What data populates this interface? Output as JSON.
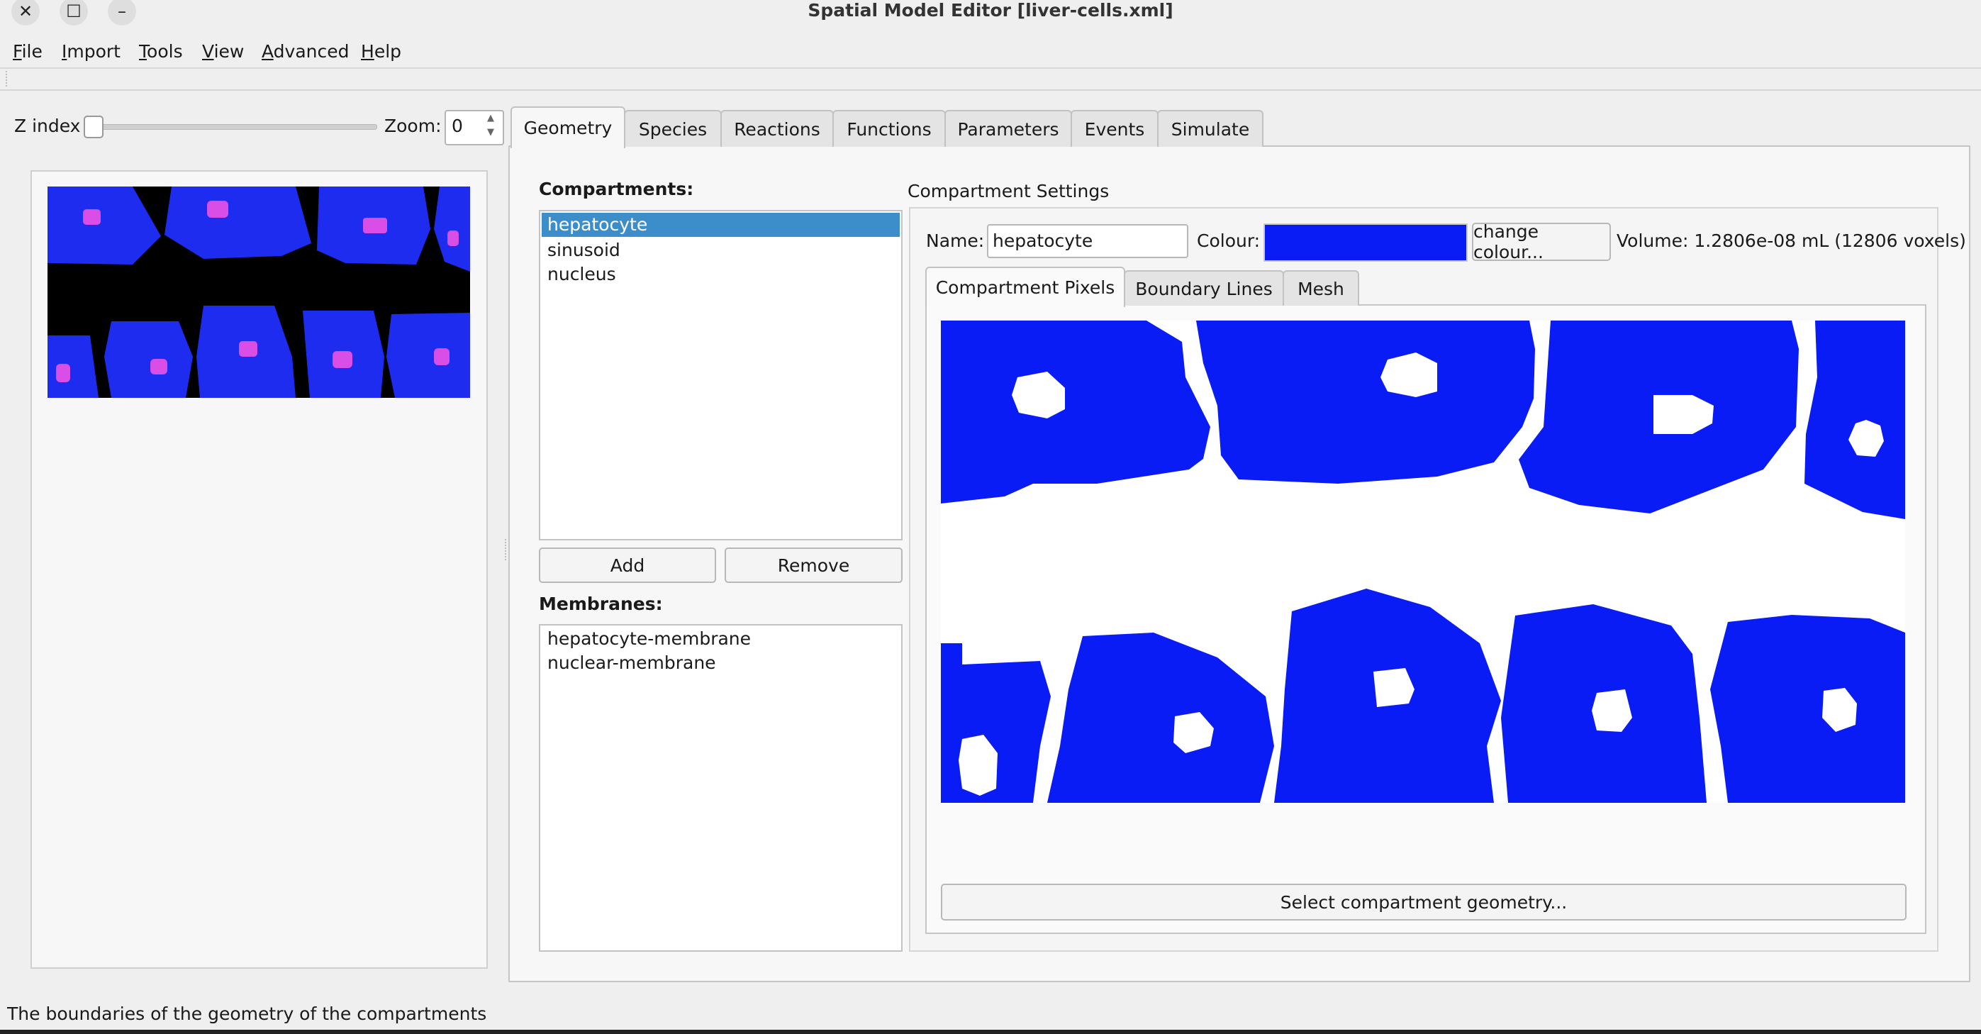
{
  "window": {
    "title": "Spatial Model Editor [liver-cells.xml]",
    "close_glyph": "✕",
    "maximize_glyph": "☐",
    "minimize_glyph": "–"
  },
  "menu": [
    {
      "mnemonic": "F",
      "rest": "ile"
    },
    {
      "mnemonic": "I",
      "rest": "mport"
    },
    {
      "mnemonic": "T",
      "rest": "ools"
    },
    {
      "mnemonic": "V",
      "rest": "iew"
    },
    {
      "mnemonic": "A",
      "rest": "dvanced"
    },
    {
      "mnemonic": "H",
      "rest": "elp"
    }
  ],
  "toolbar_left": {
    "z_index_label": "Z index",
    "zoom_label": "Zoom:",
    "zoom_value": "0",
    "z_index_level": 0
  },
  "tabs": [
    "Geometry",
    "Species",
    "Reactions",
    "Functions",
    "Parameters",
    "Events",
    "Simulate"
  ],
  "active_tab": "Geometry",
  "geometry": {
    "compartments_label": "Compartments:",
    "compartments": [
      "hepatocyte",
      "sinusoid",
      "nucleus"
    ],
    "selected_compartment": "hepatocyte",
    "add_label": "Add",
    "remove_label": "Remove",
    "membranes_label": "Membranes:",
    "membranes": [
      "hepatocyte-membrane",
      "nuclear-membrane"
    ],
    "settings": {
      "group_title": "Compartment Settings",
      "name_label": "Name:",
      "name_value": "hepatocyte",
      "colour_label": "Colour:",
      "colour_value": "#0a1cf5",
      "change_colour_label": "change colour...",
      "volume_text": "Volume: 1.2806e-08 mL (12806 voxels)",
      "subtabs": [
        "Compartment Pixels",
        "Boundary Lines",
        "Mesh"
      ],
      "active_subtab": "Compartment Pixels",
      "select_geometry_label": "Select compartment geometry..."
    }
  },
  "colors": {
    "hepatocyte": "#1e2cf0",
    "nucleus": "#d94ee6",
    "sinusoid": "#000000",
    "selection": "#3c8ecb"
  },
  "status": "The boundaries of the geometry of the compartments"
}
